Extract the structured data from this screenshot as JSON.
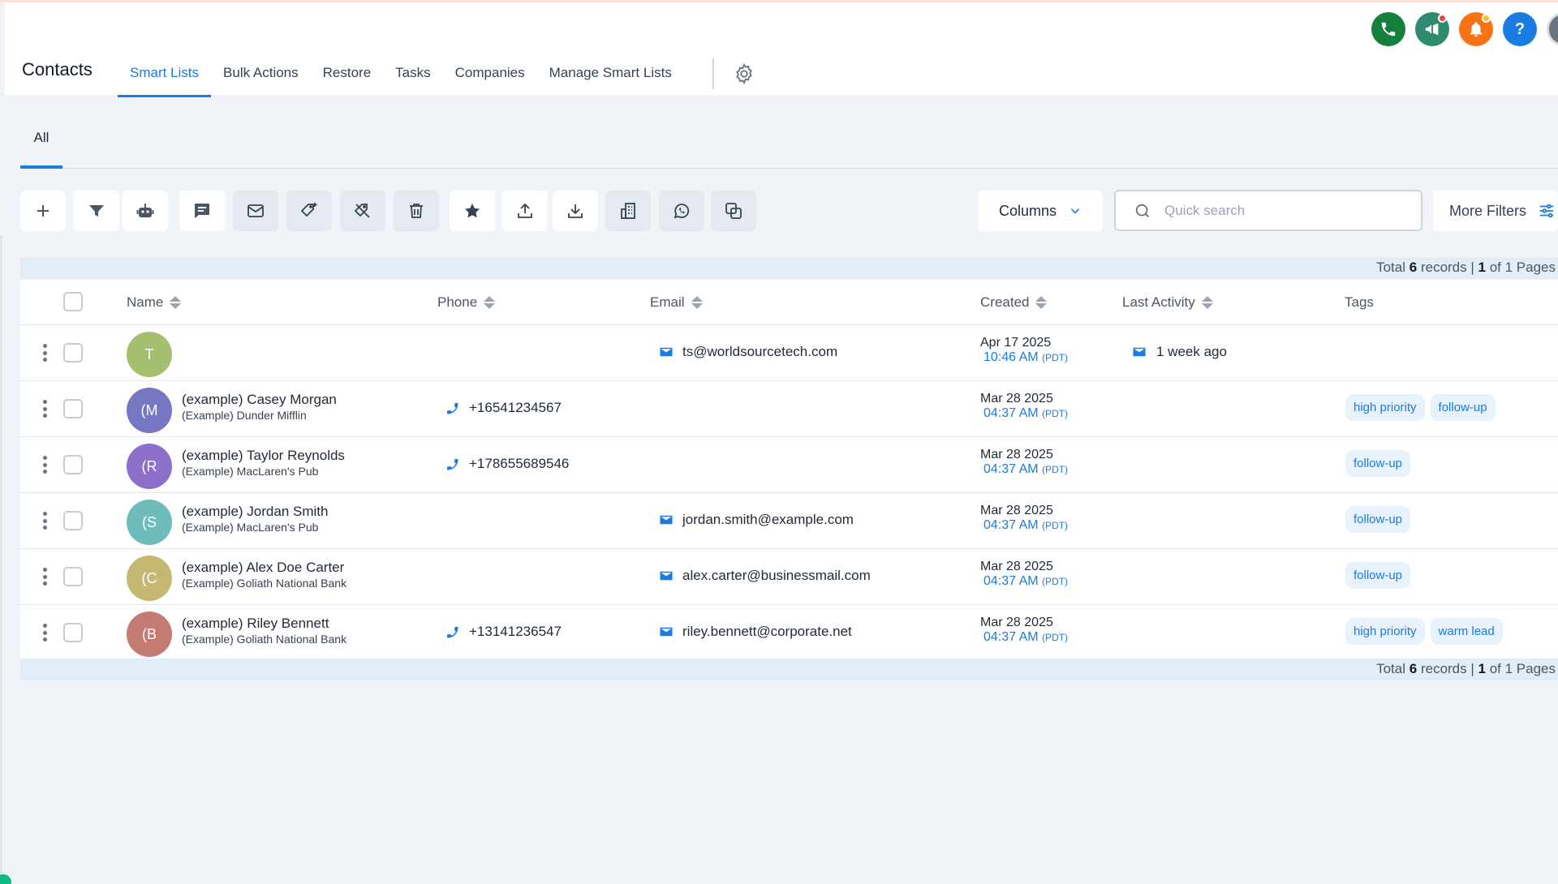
{
  "header": {
    "title": "Contacts",
    "tabs": [
      {
        "label": "Smart Lists",
        "active": true
      },
      {
        "label": "Bulk Actions",
        "active": false
      },
      {
        "label": "Restore",
        "active": false
      },
      {
        "label": "Tasks",
        "active": false
      },
      {
        "label": "Companies",
        "active": false
      },
      {
        "label": "Manage Smart Lists",
        "active": false
      }
    ],
    "settings_icon": "gear-icon",
    "top_icons": [
      {
        "name": "phone-icon",
        "color": "#15803d",
        "dot": null
      },
      {
        "name": "megaphone-icon",
        "color": "#2e8b6f",
        "dot": "#ef4444"
      },
      {
        "name": "bell-icon",
        "color": "#f97316",
        "dot": "#fbbf24"
      },
      {
        "name": "help-icon",
        "color": "#1a7be0",
        "dot": null
      }
    ]
  },
  "subtabs": {
    "all_label": "All"
  },
  "toolbar": {
    "buttons": [
      "add-icon",
      "filter-icon",
      "robot-icon",
      "message-icon",
      "mail-icon",
      "add-tag-icon",
      "remove-tag-icon",
      "trash-icon",
      "star-icon",
      "upload-icon",
      "download-icon",
      "building-icon",
      "whatsapp-icon",
      "merge-icon"
    ],
    "columns_label": "Columns",
    "search_placeholder": "Quick search",
    "more_filters_label": "More Filters"
  },
  "records": {
    "prefix": "Total",
    "count": "6",
    "mid": "records |",
    "page": "1",
    "suffix": "of 1 Pages"
  },
  "table": {
    "headers": {
      "name": "Name",
      "phone": "Phone",
      "email": "Email",
      "created": "Created",
      "last_activity": "Last Activity",
      "tags": "Tags"
    },
    "rows": [
      {
        "initials": "T",
        "avatar_color": "#a3bf6f",
        "name": "",
        "company": "",
        "phone": "",
        "email": "ts@worldsourcetech.com",
        "created_date": "Apr 17 2025",
        "created_time": "10:46 AM",
        "tz": "(PDT)",
        "activity": "1 week ago",
        "tags": []
      },
      {
        "initials": "(M",
        "avatar_color": "#7577c2",
        "name": "(example) Casey Morgan",
        "company": "(Example) Dunder Mifflin",
        "phone": "+16541234567",
        "email": "",
        "created_date": "Mar 28 2025",
        "created_time": "04:37 AM",
        "tz": "(PDT)",
        "activity": "",
        "tags": [
          "high priority",
          "follow-up"
        ]
      },
      {
        "initials": "(R",
        "avatar_color": "#8d6fcc",
        "name": "(example) Taylor Reynolds",
        "company": "(Example) MacLaren's Pub",
        "phone": "+178655689546",
        "email": "",
        "created_date": "Mar 28 2025",
        "created_time": "04:37 AM",
        "tz": "(PDT)",
        "activity": "",
        "tags": [
          "follow-up"
        ]
      },
      {
        "initials": "(S",
        "avatar_color": "#6fbcbc",
        "name": "(example) Jordan Smith",
        "company": "(Example) MacLaren's Pub",
        "phone": "",
        "email": "jordan.smith@example.com",
        "created_date": "Mar 28 2025",
        "created_time": "04:37 AM",
        "tz": "(PDT)",
        "activity": "",
        "tags": [
          "follow-up"
        ]
      },
      {
        "initials": "(C",
        "avatar_color": "#c4b872",
        "name": "(example) Alex Doe Carter",
        "company": "(Example) Goliath National Bank",
        "phone": "",
        "email": "alex.carter@businessmail.com",
        "created_date": "Mar 28 2025",
        "created_time": "04:37 AM",
        "tz": "(PDT)",
        "activity": "",
        "tags": [
          "follow-up"
        ]
      },
      {
        "initials": "(B",
        "avatar_color": "#c47b74",
        "name": "(example) Riley Bennett",
        "company": "(Example) Goliath National Bank",
        "phone": "+13141236547",
        "email": "riley.bennett@corporate.net",
        "created_date": "Mar 28 2025",
        "created_time": "04:37 AM",
        "tz": "(PDT)",
        "activity": "",
        "tags": [
          "high priority",
          "warm lead"
        ]
      }
    ]
  }
}
